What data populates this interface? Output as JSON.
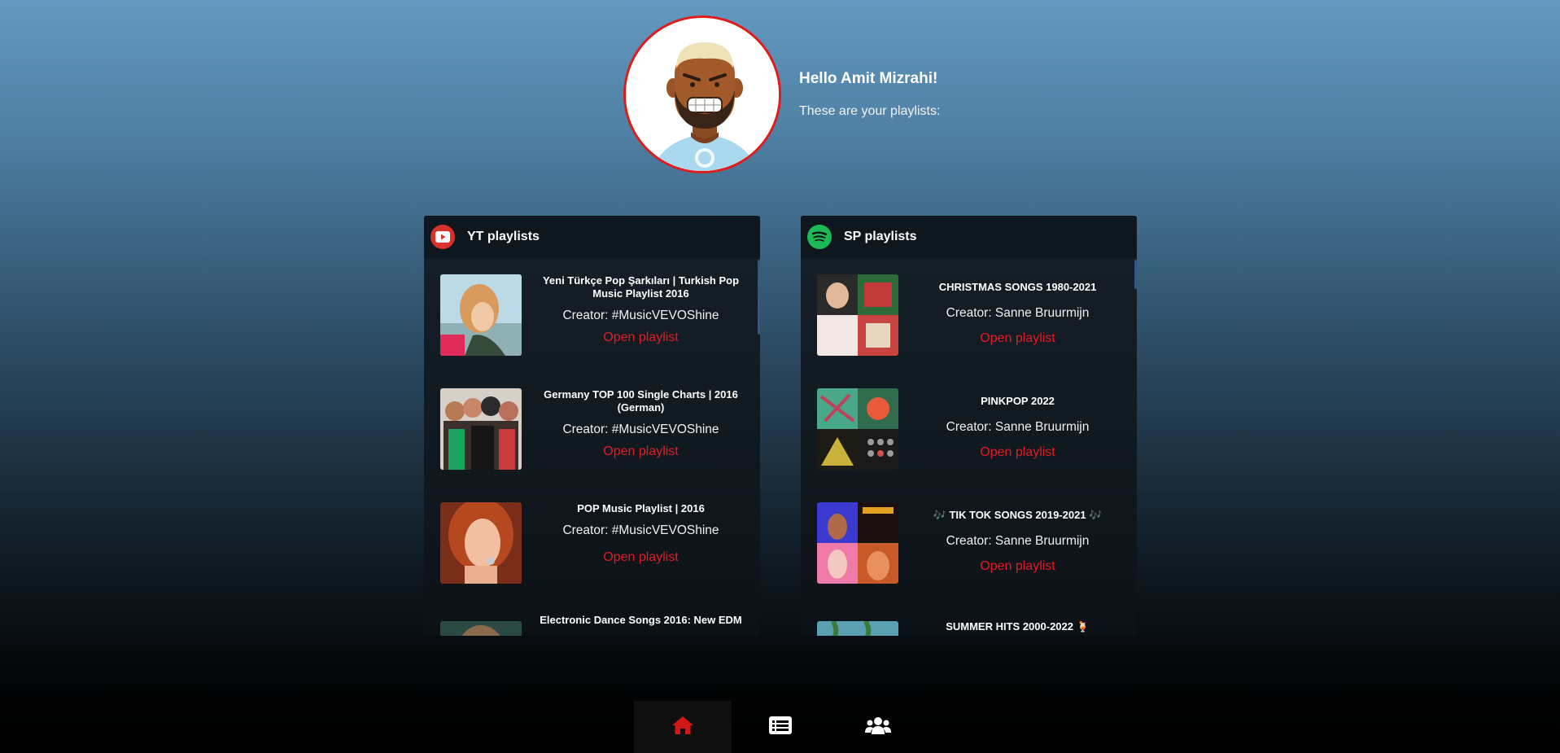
{
  "user": {
    "greeting": "Hello Amit Mizrahi!",
    "subtitle": "These are your playlists:"
  },
  "yt_panel": {
    "title": "YT playlists",
    "logo": "youtube-icon",
    "items": [
      {
        "name": "Yeni Türkçe Pop Şarkıları | Turkish Pop Music Playlist 2016",
        "creator": "Creator: #MusicVEVOShine",
        "link": "Open playlist"
      },
      {
        "name": "Germany TOP 100 Single Charts | 2016 (German)",
        "creator": "Creator: #MusicVEVOShine",
        "link": "Open playlist"
      },
      {
        "name": "POP Music Playlist | 2016",
        "creator": "Creator: #MusicVEVOShine",
        "link": "Open playlist"
      },
      {
        "name": "Electronic Dance Songs 2016: New EDM"
      }
    ]
  },
  "sp_panel": {
    "title": "SP playlists",
    "logo": "spotify-icon",
    "items": [
      {
        "name": "CHRISTMAS SONGS 1980-2021",
        "creator": "Creator: Sanne Bruurmijn",
        "link": "Open playlist"
      },
      {
        "name": "PINKPOP 2022",
        "creator": "Creator: Sanne Bruurmijn",
        "link": "Open playlist"
      },
      {
        "name": "🎶 TIK TOK SONGS 2019-2021 🎶",
        "creator": "Creator: Sanne Bruurmijn",
        "link": "Open playlist"
      },
      {
        "name": "SUMMER HITS 2000-2022 🍹"
      }
    ]
  },
  "nav": {
    "items": [
      {
        "icon": "home-icon",
        "active": true
      },
      {
        "icon": "list-icon",
        "active": false
      },
      {
        "icon": "users-icon",
        "active": false
      }
    ]
  },
  "colors": {
    "accent_red": "#e31b23",
    "youtube_red": "#d9322b",
    "spotify_green": "#1db954",
    "panel_bg": "#111920"
  }
}
